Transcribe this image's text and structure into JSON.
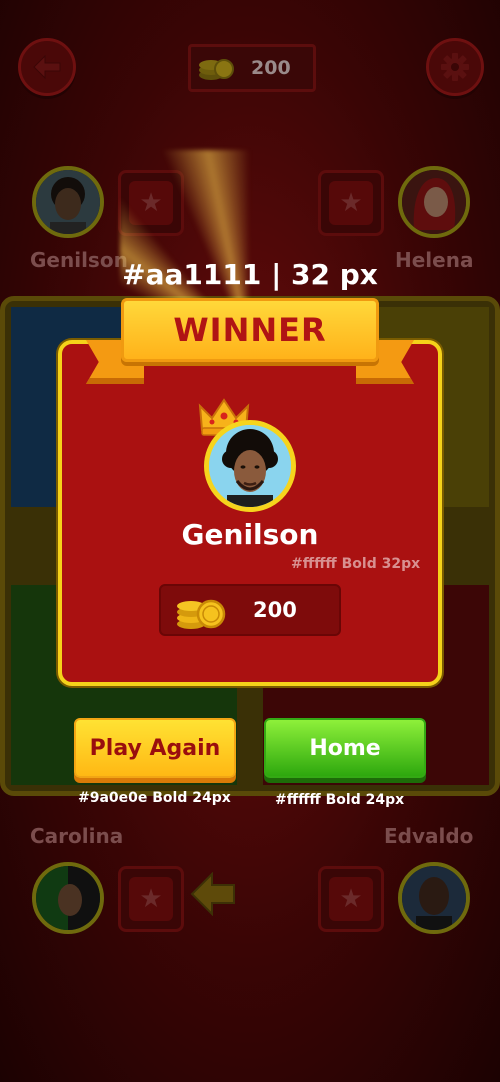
{
  "top_bar": {
    "back_icon": "arrow-left-icon",
    "coins": "200",
    "settings_icon": "gear-icon"
  },
  "players": {
    "top_left": "Genilson",
    "top_right": "Helena",
    "bottom_left": "Carolina",
    "bottom_right": "Edvaldo"
  },
  "annotations": {
    "title_spec": "#aa1111 | 32 px",
    "name_spec": "#ffffff Bold 32px",
    "play_spec": "#9a0e0e Bold 24px",
    "home_spec": "#ffffff Bold 24px"
  },
  "winner": {
    "banner": "WINNER",
    "name": "Genilson",
    "reward": "200"
  },
  "buttons": {
    "play_again": "Play Again",
    "home": "Home"
  },
  "colors": {
    "card_bg": "#aa1111",
    "card_border": "#f5d21a",
    "banner_text": "#b01414",
    "play_text": "#9a0e0e",
    "home_bg": "#3fbf12"
  }
}
